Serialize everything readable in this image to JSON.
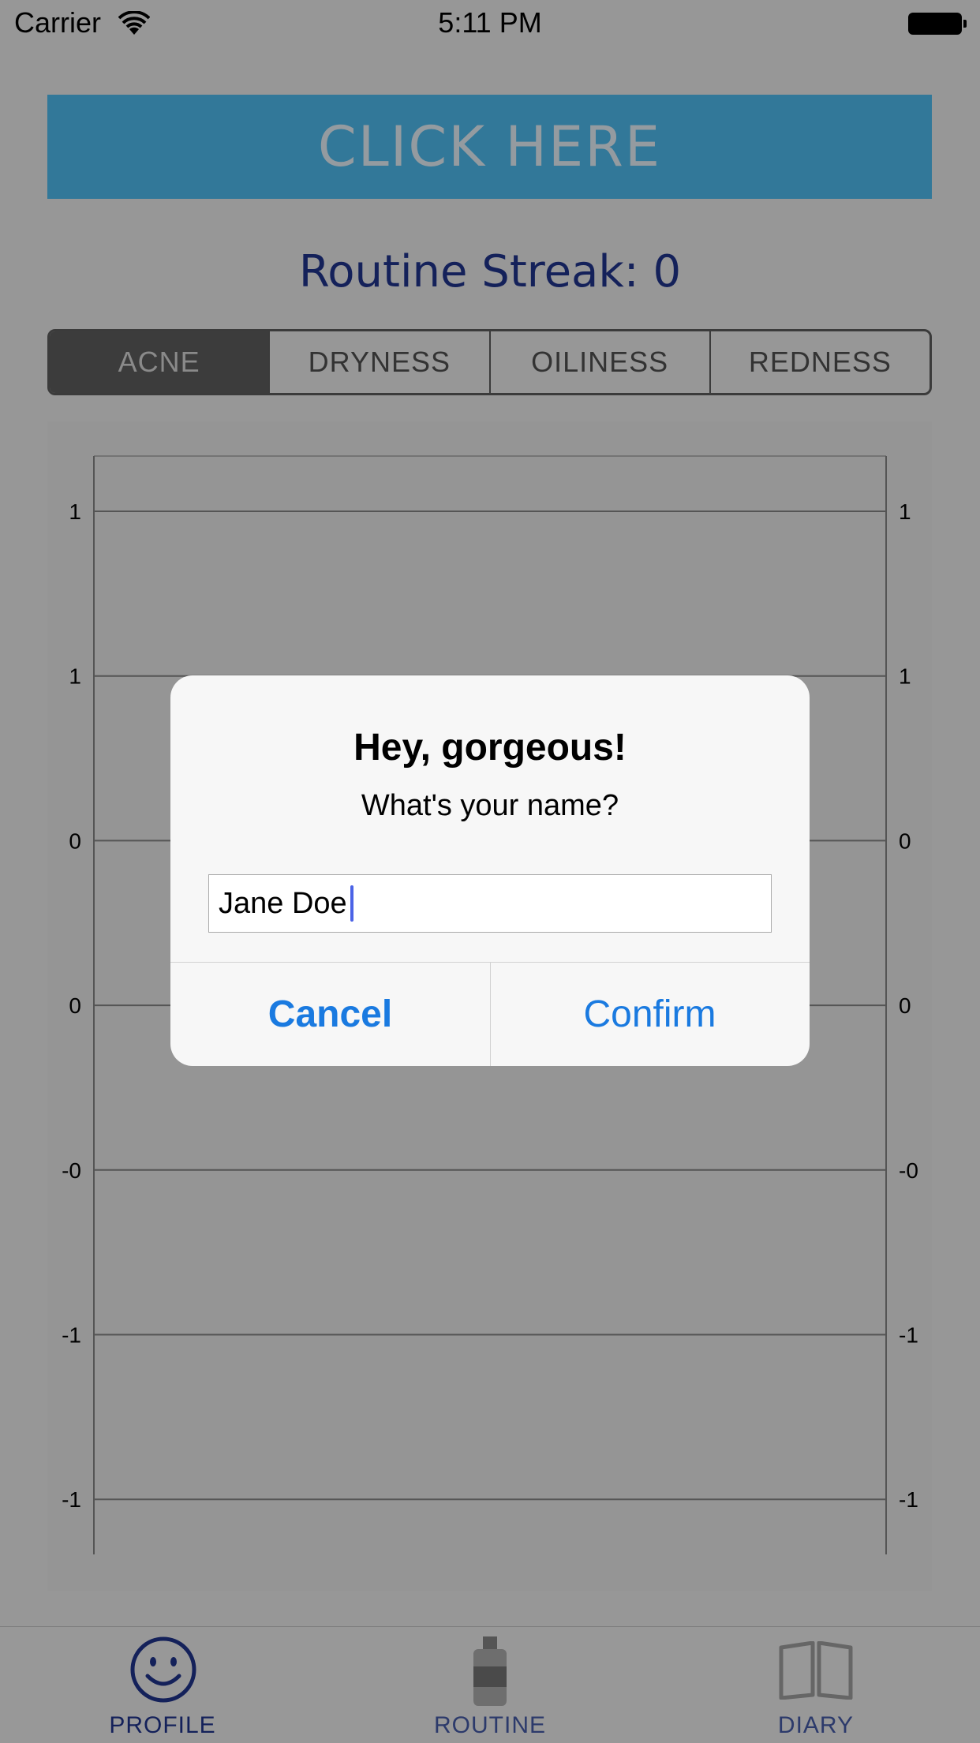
{
  "status_bar": {
    "carrier": "Carrier",
    "time": "5:11 PM"
  },
  "header": {
    "cta_label": "CLICK HERE",
    "streak_text": "Routine Streak: 0"
  },
  "segments": [
    {
      "label": "ACNE",
      "selected": true
    },
    {
      "label": "DRYNESS",
      "selected": false
    },
    {
      "label": "OILINESS",
      "selected": false
    },
    {
      "label": "REDNESS",
      "selected": false
    }
  ],
  "chart_data": {
    "type": "line",
    "series": [],
    "y_tick_labels_left": [
      "1",
      "1",
      "0",
      "0",
      "-0",
      "-1",
      "-1"
    ],
    "y_tick_labels_right": [
      "1",
      "1",
      "0",
      "0",
      "-0",
      "-1",
      "-1"
    ],
    "grid": true
  },
  "dialog": {
    "title": "Hey, gorgeous!",
    "message": "What's your name?",
    "input_value": "Jane Doe",
    "cancel_label": "Cancel",
    "confirm_label": "Confirm"
  },
  "tab_bar": {
    "tabs": [
      {
        "label": "PROFILE",
        "icon": "smiley-icon",
        "active": true
      },
      {
        "label": "ROUTINE",
        "icon": "bottle-icon",
        "active": false
      },
      {
        "label": "DIARY",
        "icon": "book-icon",
        "active": false
      }
    ]
  },
  "colors": {
    "accent_blue": "#327899",
    "navy_text": "#14215a",
    "dialog_button": "#1a7ae0",
    "dim_background": "#979797"
  }
}
